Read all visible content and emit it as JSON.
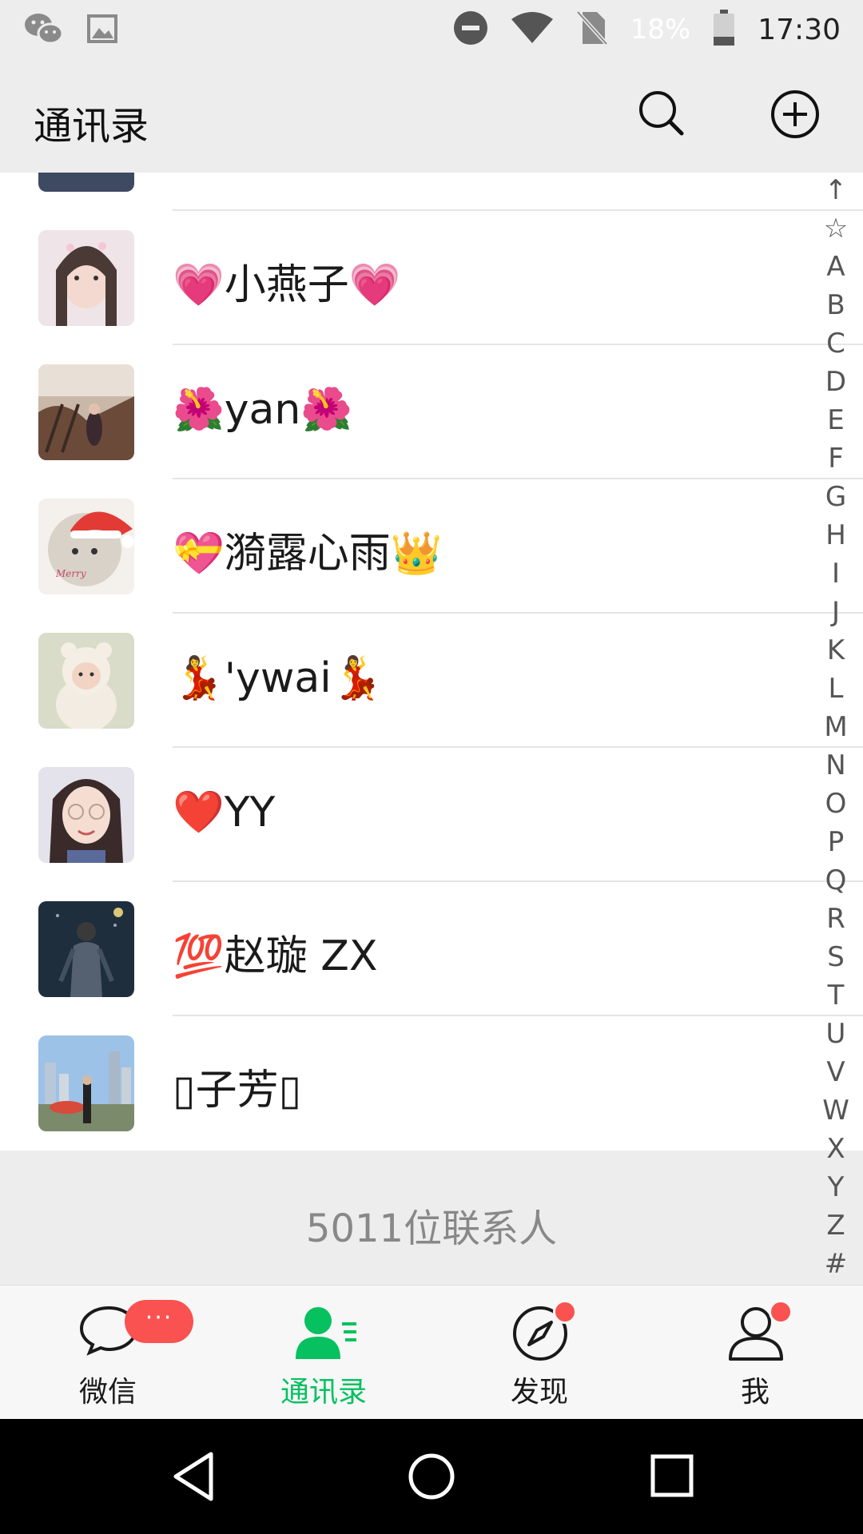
{
  "status_bar": {
    "battery_percent": "18%",
    "time": "17:30",
    "icons": [
      "wechat-icon",
      "image-icon",
      "do-not-disturb-icon",
      "wifi-icon",
      "no-sim-icon",
      "battery-icon"
    ]
  },
  "header": {
    "title": "通讯录",
    "icons": [
      "search-icon",
      "add-circle-icon"
    ]
  },
  "contacts": [
    {
      "name": "💗小燕子💗"
    },
    {
      "name": "🌺yan🌺"
    },
    {
      "name": "💝漪露心雨👑"
    },
    {
      "name": "💃'ywai💃"
    },
    {
      "name": "❤️YY"
    },
    {
      "name": "💯赵璇 ZX"
    },
    {
      "name": "▯子芳▯"
    }
  ],
  "contact_count": "5011位联系人",
  "index_bar": [
    "↑",
    "☆",
    "A",
    "B",
    "C",
    "D",
    "E",
    "F",
    "G",
    "H",
    "I",
    "J",
    "K",
    "L",
    "M",
    "N",
    "O",
    "P",
    "Q",
    "R",
    "S",
    "T",
    "U",
    "V",
    "W",
    "X",
    "Y",
    "Z",
    "#"
  ],
  "tabs": [
    {
      "label": "微信",
      "badge": "···"
    },
    {
      "label": "通讯录"
    },
    {
      "label": "发现"
    },
    {
      "label": "我"
    }
  ],
  "colors": {
    "accent": "#07c160",
    "badge": "#fa5151",
    "header_bg": "#ededed"
  }
}
